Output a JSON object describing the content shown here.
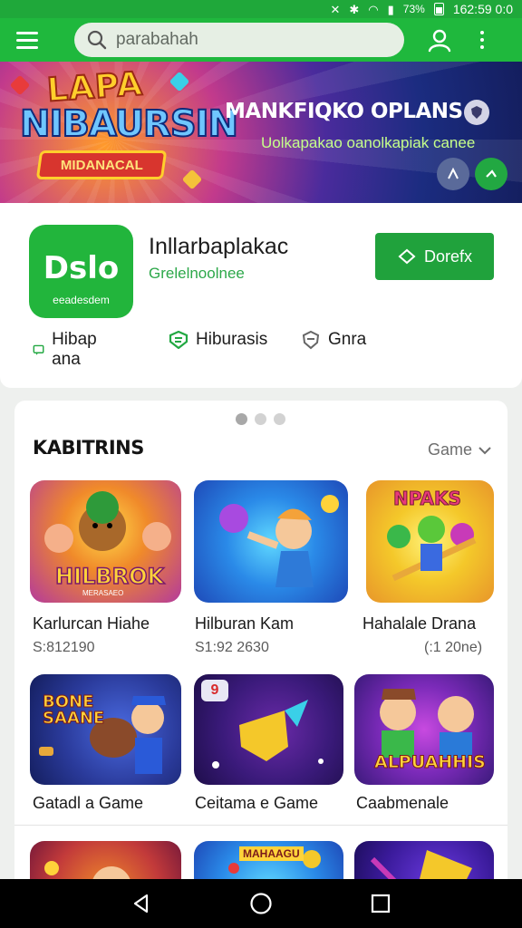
{
  "status_bar": {
    "battery": "73%",
    "time": "162:59 0:0"
  },
  "app_bar": {
    "search_placeholder": "parabahah"
  },
  "banner": {
    "logo_line1": "LAPA",
    "logo_line2": "NIBAURSIN",
    "logo_ribbon": "MIDANACAL",
    "title": "MANKFIQKO OPLANS",
    "subtitle": "Uolkapakao oanolkapiak canee"
  },
  "app": {
    "icon_text": "Dslo",
    "icon_subtext": "eeadesdem",
    "name": "Inllarbaplakac",
    "developer": "Grelelnoolnee",
    "install_label": "Dorefx",
    "chips": [
      "Hibap ana",
      "Hiburasis",
      "Gnra"
    ]
  },
  "games": {
    "title": "KABITRINS",
    "filter_label": "Game",
    "items": [
      {
        "name": "Karlurcan Hiahe",
        "price": "S:812190",
        "art_text": "HILBROK",
        "art_sub": "MERASAEO"
      },
      {
        "name": "Hilburan Kam",
        "price": "S1:92 2630"
      },
      {
        "name": "Hahalale Drana",
        "price": "(:1 20ne)",
        "art_text": "NPAKS"
      },
      {
        "name": "Gatadl a Game",
        "price": "",
        "art_text": "BONE SAANE"
      },
      {
        "name": "Ceitama e Game",
        "price": "",
        "art_text": "9"
      },
      {
        "name": "Caabmenale",
        "price": "",
        "art_text": "ALPUAHHIS"
      },
      {
        "art_text": "MAHAAGU"
      }
    ]
  },
  "colors": {
    "brand_green": "#1fb83d",
    "install_green": "#20a23c",
    "banner_navy": "#1b2c80"
  }
}
